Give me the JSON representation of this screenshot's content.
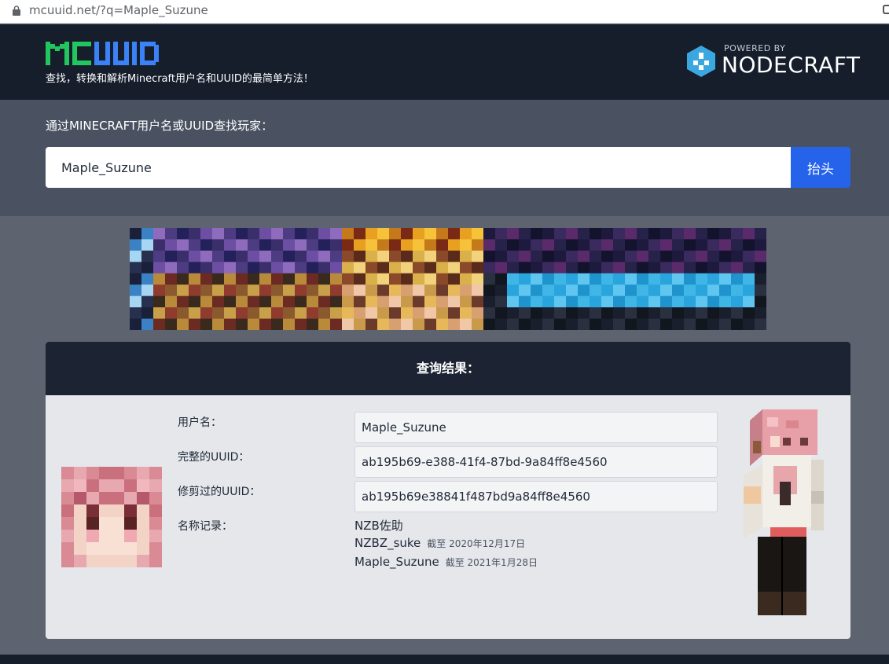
{
  "browser": {
    "url": "mcuuid.net/?q=Maple_Suzune"
  },
  "header": {
    "logo_text": "MCUUID",
    "tagline": "查找，转换和解析Minecraft用户名和UUID的最简单方法！",
    "powered_by": "POWERED BY",
    "sponsor": "NODECRAFT"
  },
  "search": {
    "label": "通过MINECRAFT用户名或UUID查找玩家：",
    "value": "Maple_Suzune",
    "button": "抬头"
  },
  "result": {
    "title": "查询结果：",
    "username_label": "用户名：",
    "username": "Maple_Suzune",
    "full_uuid_label": "完整的UUID：",
    "full_uuid": "ab195b69-e388-41f4-87bd-9a84ff8e4560",
    "trimmed_uuid_label": "修剪过的UUID：",
    "trimmed_uuid": "ab195b69e38841f487bd9a84ff8e4560",
    "history_label": "名称记录：",
    "history": [
      {
        "name": "NZB佐助",
        "date": ""
      },
      {
        "name": "NZBZ_suke",
        "date": "截至 2020年12月17日"
      },
      {
        "name": "Maple_Suzune",
        "date": "截至 2021年1月28日"
      }
    ]
  },
  "colors": {
    "header_bg": "#161e2c",
    "search_bg": "#4a5262",
    "button": "#2563eb",
    "logo_green": "#2ecc71",
    "logo_blue": "#3b82f6"
  }
}
